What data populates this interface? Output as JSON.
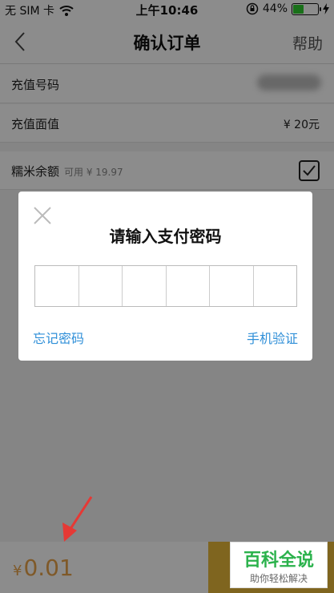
{
  "status_bar": {
    "carrier": "无 SIM 卡",
    "time": "上午10:46",
    "battery": "44%",
    "battery_level": 0.44
  },
  "nav": {
    "title": "确认订单",
    "help": "帮助"
  },
  "order": {
    "recharge_number_label": "充值号码",
    "recharge_value_label": "充值面值",
    "recharge_value": "¥ 20元",
    "balance_label": "糯米余额",
    "balance_available": "可用 ¥ 19.97",
    "balance_checked": true
  },
  "bottom": {
    "currency": "¥",
    "total": "0.01"
  },
  "dialog": {
    "title": "请输入支付密码",
    "pin_cells": 6,
    "forgot_password": "忘记密码",
    "phone_verify": "手机验证"
  },
  "watermark": {
    "title": "百科全说",
    "subtitle": "助你轻松解决"
  },
  "colors": {
    "link": "#2f8fd8",
    "total": "#e8a24a",
    "pay_button": "#e8b83a",
    "arrow": "#e53935",
    "watermark_green": "#2bb24c"
  }
}
